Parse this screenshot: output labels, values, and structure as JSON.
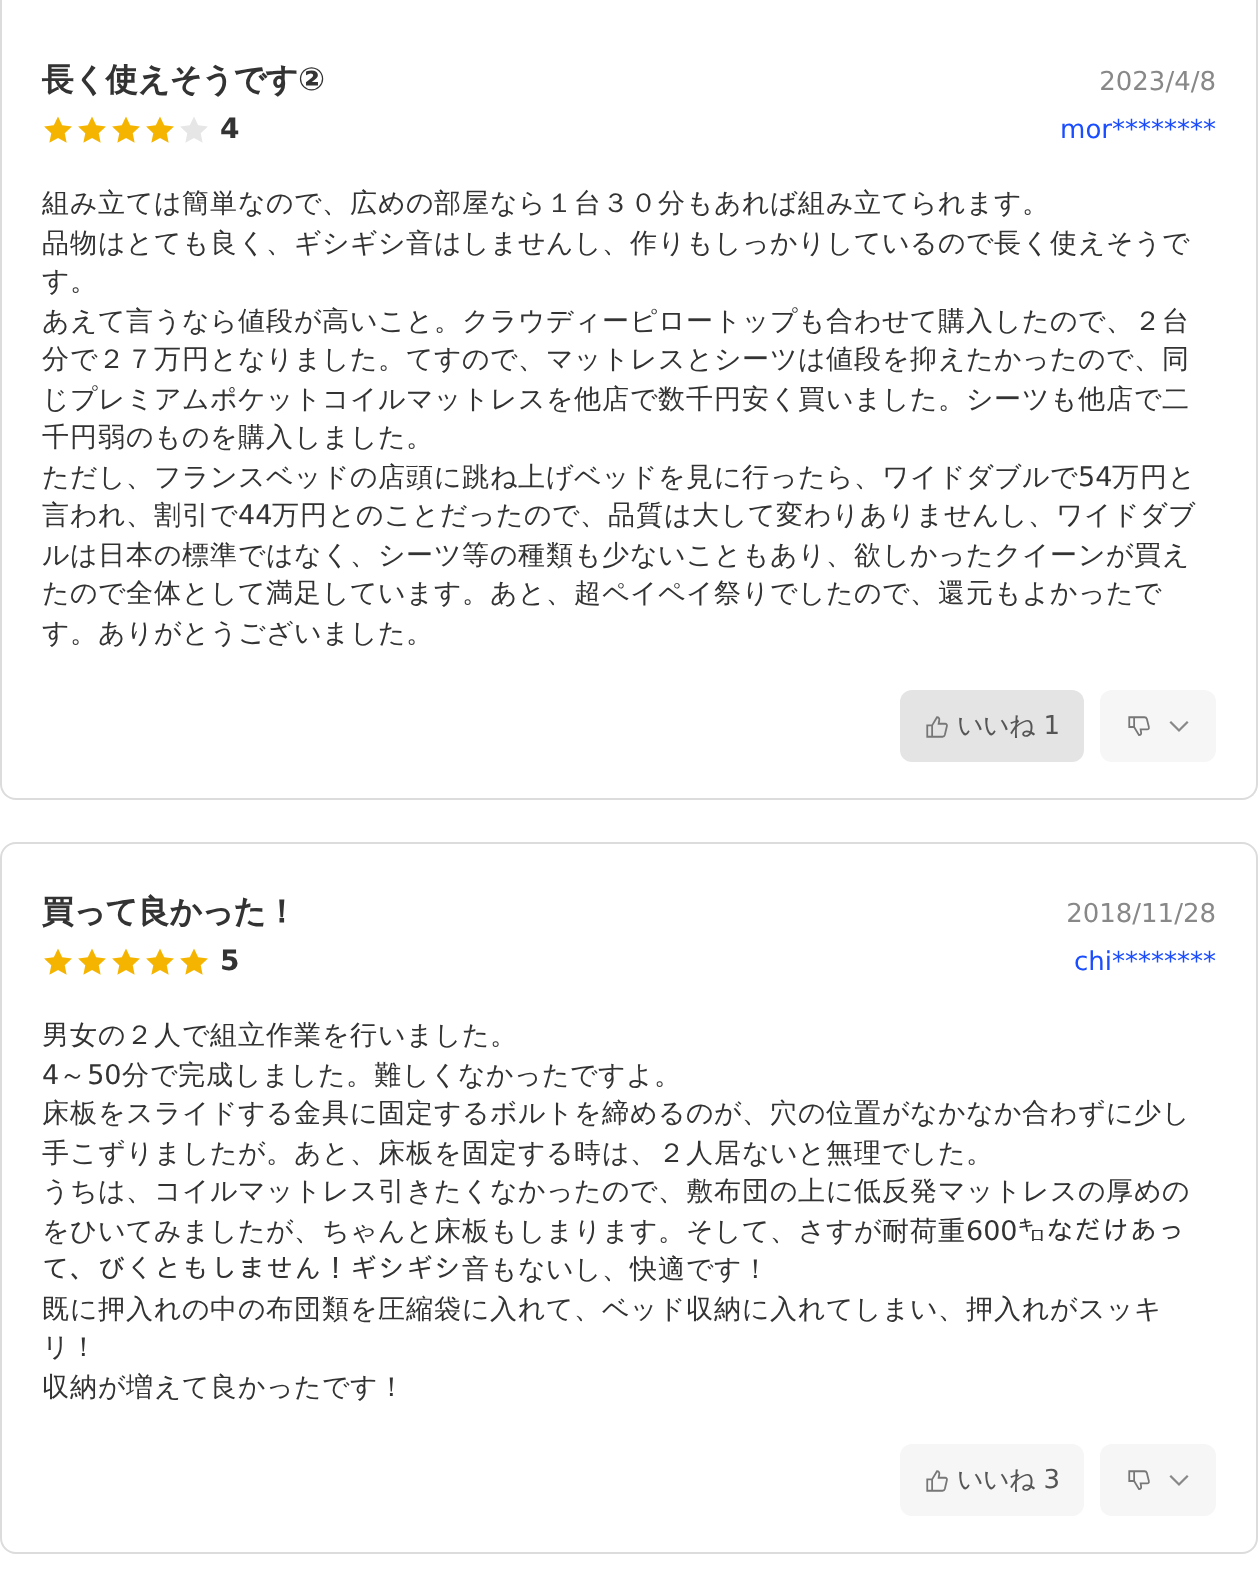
{
  "reviews": [
    {
      "title": "長く使えそうです②",
      "date": "2023/4/8",
      "stars": 4,
      "rating": "4",
      "user": "mor********",
      "body": [
        "組み立ては簡単なので、広めの部屋なら１台３０分もあれば組み立てられます。",
        "品物はとても良く、ギシギシ音はしませんし、作りもしっかりしているので長く使えそうです。",
        "あえて言うなら値段が高いこと。クラウディーピロートップも合わせて購入したので、２台分で２７万円となりました。てすので、マットレスとシーツは値段を抑えたかったので、同じプレミアムポケットコイルマットレスを他店で数千円安く買いました。シーツも他店で二千円弱のものを購入しました。",
        "ただし、フランスベッドの店頭に跳ね上げベッドを見に行ったら、ワイドダブルで54万円と言われ、割引で44万円とのことだったので、品質は大して変わりありませんし、ワイドダブルは日本の標準ではなく、シーツ等の種類も少ないこともあり、欲しかったクイーンが買えたので全体として満足しています。あと、超ペイペイ祭りでしたので、還元もよかったです。ありがとうございました。"
      ],
      "like": {
        "label": "いいね 1",
        "selected": true
      }
    },
    {
      "title": "買って良かった！",
      "date": "2018/11/28",
      "stars": 5,
      "rating": "5",
      "user": "chi********",
      "body": [
        "男女の２人で組立作業を行いました。",
        "4～50分で完成しました。難しくなかったですよ。",
        "床板をスライドする金具に固定するボルトを締めるのが、穴の位置がなかなか合わずに少し手こずりましたが。あと、床板を固定する時は、２人居ないと無理でした。",
        "うちは、コイルマットレス引きたくなかったので、敷布団の上に低反発マットレスの厚めのをひいてみましたが、ちゃんと床板もしまります。そして、さすが耐荷重600㌔なだけあって、びくともしません！ギシギシ音もないし、快適です！",
        "既に押入れの中の布団類を圧縮袋に入れて、ベッド収納に入れてしまい、押入れがスッキリ！",
        "収納が増えて良かったです！"
      ],
      "like": {
        "label": "いいね 3",
        "selected": false
      }
    }
  ]
}
